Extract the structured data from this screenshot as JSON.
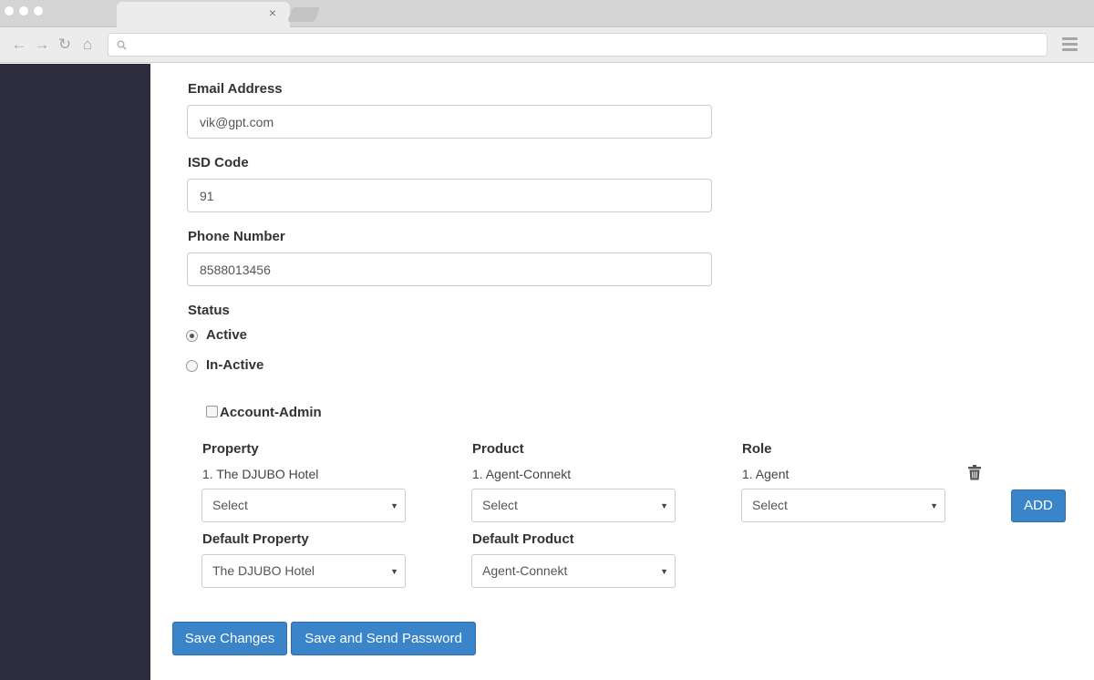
{
  "browser": {
    "icons": [
      "back-arrow-icon",
      "forward-arrow-icon",
      "reload-icon",
      "home-icon",
      "search-icon",
      "menu-icon",
      "close-icon"
    ],
    "back_glyph": "←",
    "forward_glyph": "→",
    "reload_glyph": "↻",
    "home_glyph": "⌂",
    "close_glyph": "×"
  },
  "colors": {
    "sidebar": "#2c2c3c",
    "accent": "#3a84c9"
  },
  "form": {
    "email": {
      "label": "Email Address",
      "value": "vik@gpt.com"
    },
    "isd": {
      "label": "ISD Code",
      "value": "91"
    },
    "phone": {
      "label": "Phone Number",
      "value": "8588013456"
    },
    "status": {
      "label": "Status",
      "options": [
        {
          "label": "Active",
          "selected": true
        },
        {
          "label": "In-Active",
          "selected": false
        }
      ]
    },
    "account_admin": {
      "label": "Account-Admin",
      "checked": false
    }
  },
  "assignments": {
    "headers": {
      "property": "Property",
      "product": "Product",
      "role": "Role"
    },
    "rows": [
      {
        "property": "1. The DJUBO Hotel",
        "product": "1. Agent-Connekt",
        "role": "1. Agent"
      }
    ],
    "selects": {
      "property": "Select",
      "product": "Select",
      "role": "Select"
    },
    "caret": "▼",
    "add_label": "ADD",
    "trash_icon": "trash-icon"
  },
  "defaults": {
    "property": {
      "label": "Default Property",
      "value": "The DJUBO Hotel"
    },
    "product": {
      "label": "Default Product",
      "value": "Agent-Connekt"
    }
  },
  "actions": {
    "save_label": "Save Changes",
    "save_send_label": "Save and Send Password"
  }
}
